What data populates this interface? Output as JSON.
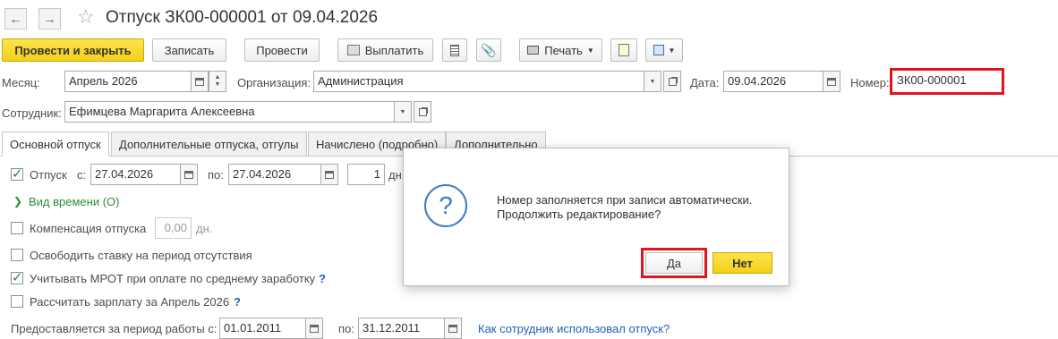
{
  "header": {
    "title": "Отпуск ЗК00-000001 от 09.04.2026",
    "back_glyph": "←",
    "forward_glyph": "→",
    "star_glyph": "☆"
  },
  "toolbar": {
    "post_close_label": "Провести и закрыть",
    "save_label": "Записать",
    "post_label": "Провести",
    "pay_label": "Выплатить",
    "print_label": "Печать"
  },
  "form": {
    "month_label": "Месяц:",
    "month_value": "Апрель 2026",
    "org_label": "Организация:",
    "org_value": "Администрация",
    "date_label": "Дата:",
    "date_value": "09.04.2026",
    "number_label": "Номер:",
    "number_value": "ЗК00-000001",
    "employee_label": "Сотрудник:",
    "employee_value": "Ефимцева Маргарита Алексеевна"
  },
  "tabs": [
    {
      "label": "Основной отпуск"
    },
    {
      "label": "Дополнительные отпуска, отгулы"
    },
    {
      "label": "Начислено (подробно)"
    },
    {
      "label": "Дополнительно"
    }
  ],
  "main": {
    "vacation_label": "Отпуск",
    "from_label": "с:",
    "from_value": "27.04.2026",
    "to_label": "по:",
    "to_value": "27.04.2026",
    "days_value": "1",
    "days_unit": "дн",
    "time_kind_link": "Вид времени (О)",
    "compensation_label": "Компенсация отпуска",
    "compensation_value": "0,00",
    "compensation_unit": "дн.",
    "free_rate_label": "Освободить ставку на период отсутствия",
    "mrot_label": "Учитывать МРОТ при оплате по среднему заработку",
    "calc_salary_label": "Рассчитать зарплату за Апрель 2026",
    "period_label": "Предоставляется за период работы с:",
    "period_from": "01.01.2011",
    "period_to_label": "по:",
    "period_to": "31.12.2011",
    "usage_link": "Как сотрудник использовал отпуск?",
    "help_mark": "?"
  },
  "dialog": {
    "question_mark": "?",
    "message_line1": "Номер заполняется при записи автоматически.",
    "message_line2": "Продолжить редактирование?",
    "yes_label": "Да",
    "no_label": "Нет"
  },
  "colors": {
    "highlight": "#e0141e",
    "primary_button": "#f4cf1a",
    "link": "#1b62b6",
    "check": "#2e8b3c"
  }
}
